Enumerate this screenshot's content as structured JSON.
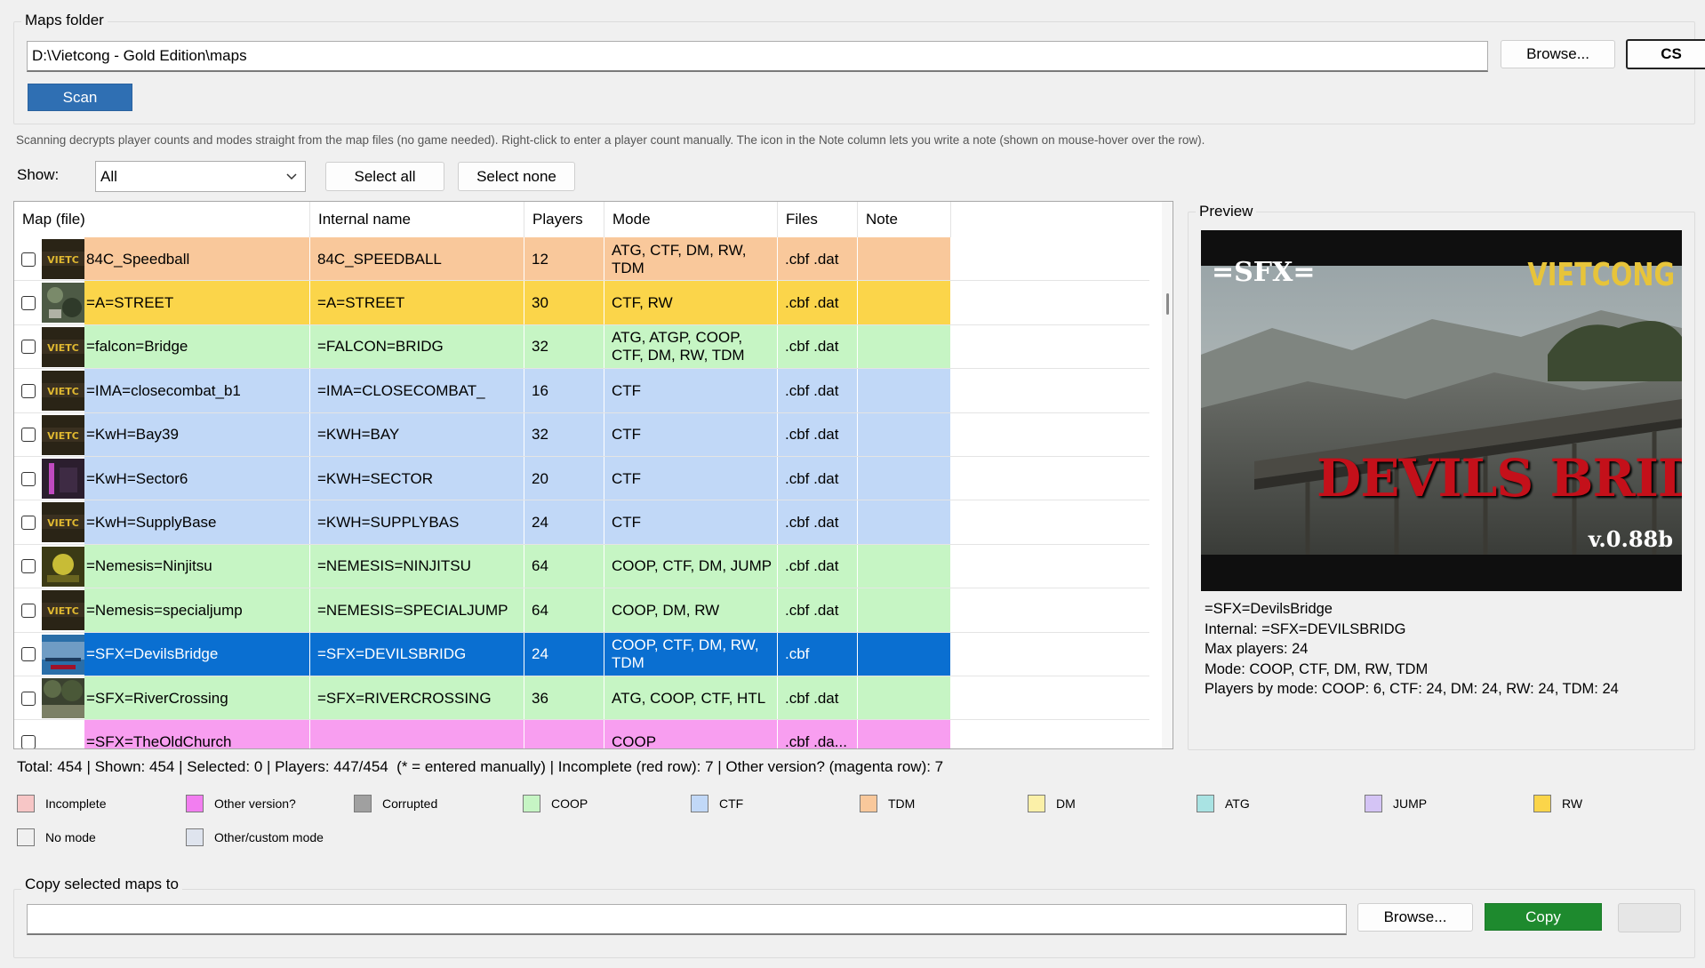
{
  "maps_folder": {
    "title": "Maps folder",
    "path": "D:\\Vietcong - Gold Edition\\maps",
    "browse_label": "Browse...",
    "cs_label": "CS",
    "scan_label": "Scan"
  },
  "hint_text": "Scanning decrypts player counts and modes straight from the map files (no game needed). Right-click to enter a player count manually. The icon in the Note column lets you write a note (shown on mouse-hover over the row).",
  "filter": {
    "show_label": "Show:",
    "selected": "All",
    "select_all_label": "Select all",
    "select_none_label": "Select none"
  },
  "table": {
    "columns": [
      "Map (file)",
      "Internal name",
      "Players",
      "Mode",
      "Files",
      "Note"
    ],
    "rows": [
      {
        "file": "84C_Speedball",
        "internal": "84C_SPEEDBALL",
        "players": "12",
        "mode": "ATG, CTF, DM, RW, TDM",
        "files": ".cbf .dat",
        "note": "",
        "color": "#f9c89b",
        "thumb": "vietcong-logo"
      },
      {
        "file": "=A=STREET",
        "internal": "=A=STREET",
        "players": "30",
        "mode": "CTF, RW",
        "files": ".cbf .dat",
        "note": "",
        "color": "#fbd54a",
        "thumb": "jungle"
      },
      {
        "file": "=falcon=Bridge",
        "internal": "=FALCON=BRIDG",
        "players": "32",
        "mode": "ATG, ATGP, COOP, CTF, DM, RW, TDM",
        "files": ".cbf .dat",
        "note": "",
        "color": "#c6f5c4",
        "thumb": "vietcong-logo"
      },
      {
        "file": "=IMA=closecombat_b1",
        "internal": "=IMA=CLOSECOMBAT_",
        "players": "16",
        "mode": "CTF",
        "files": ".cbf .dat",
        "note": "",
        "color": "#c1d8f7",
        "thumb": "vietcong-logo"
      },
      {
        "file": "=KwH=Bay39",
        "internal": "=KWH=BAY",
        "players": "32",
        "mode": "CTF",
        "files": ".cbf .dat",
        "note": "",
        "color": "#c1d8f7",
        "thumb": "vietcong-logo"
      },
      {
        "file": "=KwH=Sector6",
        "internal": "=KWH=SECTOR",
        "players": "20",
        "mode": "CTF",
        "files": ".cbf .dat",
        "note": "",
        "color": "#c1d8f7",
        "thumb": "dark"
      },
      {
        "file": "=KwH=SupplyBase",
        "internal": "=KWH=SUPPLYBAS",
        "players": "24",
        "mode": "CTF",
        "files": ".cbf .dat",
        "note": "",
        "color": "#c1d8f7",
        "thumb": "vietcong-logo"
      },
      {
        "file": "=Nemesis=Ninjitsu",
        "internal": "=NEMESIS=NINJITSU",
        "players": "64",
        "mode": "COOP, CTF, DM, JUMP",
        "files": ".cbf .dat",
        "note": "",
        "color": "#c6f5c4",
        "thumb": "olive"
      },
      {
        "file": "=Nemesis=specialjump",
        "internal": "=NEMESIS=SPECIALJUMP",
        "players": "64",
        "mode": "COOP, DM, RW",
        "files": ".cbf .dat",
        "note": "",
        "color": "#c6f5c4",
        "thumb": "vietcong-logo"
      },
      {
        "file": "=SFX=DevilsBridge",
        "internal": "=SFX=DEVILSBRIDG",
        "players": "24",
        "mode": "COOP, CTF, DM, RW, TDM",
        "files": ".cbf",
        "note": "",
        "color": "#0a6fd1",
        "thumb": "bridge",
        "selected": true
      },
      {
        "file": "=SFX=RiverCrossing",
        "internal": "=SFX=RIVERCROSSING",
        "players": "36",
        "mode": "ATG, COOP, CTF, HTL",
        "files": ".cbf .dat",
        "note": "",
        "color": "#c6f5c4",
        "thumb": "forest"
      },
      {
        "file": "=SFX=TheOldChurch",
        "internal": "",
        "players": "",
        "mode": "COOP",
        "files": ".cbf .da...",
        "note": "",
        "color": "#f89ef0",
        "thumb": "none"
      }
    ]
  },
  "preview": {
    "title": "Preview",
    "image_tag": "=SFX=",
    "image_brand": "VIETCONG",
    "image_title": "DEVILS BRIDGE",
    "image_version": "v.0.88b",
    "info_lines": [
      "=SFX=DevilsBridge",
      "Internal: =SFX=DEVILSBRIDG",
      "Max players: 24",
      "Mode: COOP, CTF, DM, RW, TDM",
      "Players by mode: COOP: 6, CTF: 24, DM: 24, RW: 24, TDM: 24"
    ]
  },
  "status_text": "Total: 454 | Shown: 454 | Selected: 0 | Players: 447/454  (* = entered manually) | Incomplete (red row): 7 | Other version? (magenta row): 7",
  "legend": [
    {
      "label": "Incomplete",
      "color": "#f7c6c6"
    },
    {
      "label": "Other version?",
      "color": "#f27ef0"
    },
    {
      "label": "Corrupted",
      "color": "#a0a0a0"
    },
    {
      "label": "COOP",
      "color": "#c6f5c4"
    },
    {
      "label": "CTF",
      "color": "#c1d8f7"
    },
    {
      "label": "TDM",
      "color": "#f9c89b"
    },
    {
      "label": "DM",
      "color": "#fbf0a8"
    },
    {
      "label": "ATG",
      "color": "#a9e3e3"
    },
    {
      "label": "JUMP",
      "color": "#d4c4f5"
    },
    {
      "label": "RW",
      "color": "#fbd54a"
    },
    {
      "label": "No mode",
      "color": "#f0f0f0"
    },
    {
      "label": "Other/custom mode",
      "color": "#dfe4ee"
    }
  ],
  "copy": {
    "title": "Copy selected maps to",
    "path": "",
    "browse_label": "Browse...",
    "copy_label": "Copy",
    "extra_label": ""
  },
  "colors": {
    "scan_button": "#2f6fb3",
    "copy_button": "#1e8a2e",
    "selection": "#0a6fd1"
  }
}
